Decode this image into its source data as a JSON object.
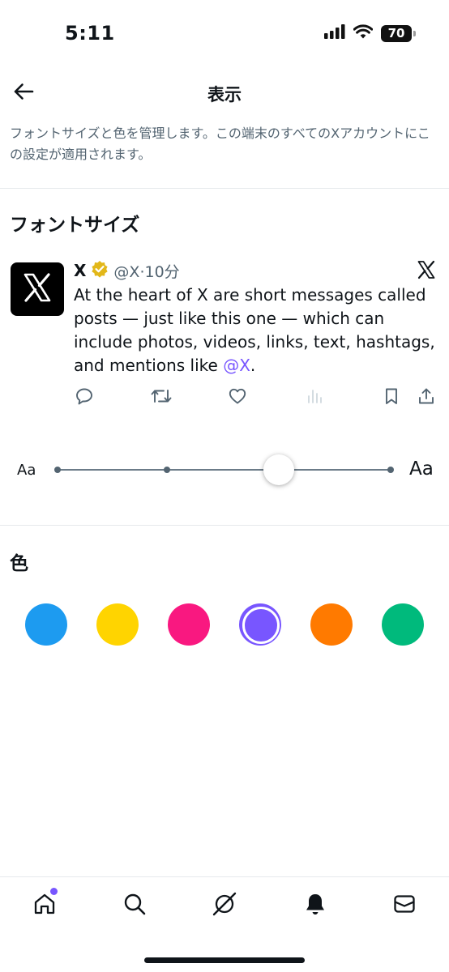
{
  "status_bar": {
    "time": "5:11",
    "battery": "70"
  },
  "header": {
    "title": "表示"
  },
  "description": "フォントサイズと色を管理します。この端末のすべてのXアカウントにこの設定が適用されます。",
  "font_size_section": {
    "title": "フォントサイズ"
  },
  "sample_post": {
    "name": "X",
    "meta": "@X·10分",
    "body_text": "At the heart of X are short messages called posts — just like this one — which can include photos, videos, links, text, hashtags, and mentions like ",
    "mention": "@X",
    "body_end": "."
  },
  "font_slider": {
    "small_label": "Aa",
    "large_label": "Aa",
    "steps": 4,
    "selected_step": 3
  },
  "color_section": {
    "title": "色",
    "swatches": [
      {
        "name": "blue",
        "color": "#1d9bf0",
        "selected": false
      },
      {
        "name": "yellow",
        "color": "#ffd400",
        "selected": false
      },
      {
        "name": "pink",
        "color": "#f91880",
        "selected": false
      },
      {
        "name": "purple",
        "color": "#7856ff",
        "selected": true
      },
      {
        "name": "orange",
        "color": "#ff7a00",
        "selected": false
      },
      {
        "name": "green",
        "color": "#00ba7c",
        "selected": false
      }
    ]
  },
  "tab_bar": {
    "items": [
      "home-icon",
      "search-icon",
      "grok-icon",
      "notifications-icon",
      "messages-icon"
    ],
    "home_badge_color": "#7856ff"
  },
  "colors": {
    "text": "#0f1419",
    "secondary": "#536471",
    "accent": "#7856ff",
    "divider": "#e6e9ec"
  }
}
